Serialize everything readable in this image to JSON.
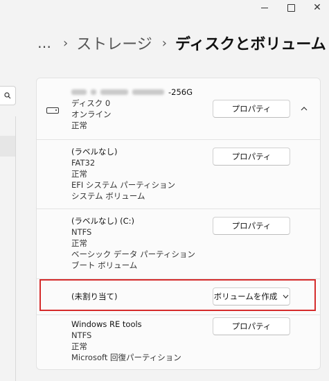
{
  "window_controls": {
    "close_glyph": "✕"
  },
  "breadcrumb": {
    "more": "…",
    "separator": "›",
    "parent": "ストレージ",
    "current": "ディスクとボリューム"
  },
  "disk": {
    "title_suffix": "-256G",
    "name": "ディスク 0",
    "status": "オンライン",
    "health": "正常",
    "properties_label": "プロパティ",
    "collapse_icon": "chevron-up-icon"
  },
  "partitions": [
    {
      "label": "(ラベルなし)",
      "fs": "FAT32",
      "health": "正常",
      "type": "EFI システム パーティション",
      "role": "システム ボリューム",
      "action": "プロパティ"
    },
    {
      "label": "(ラベルなし) (C:)",
      "fs": "NTFS",
      "health": "正常",
      "type": "ベーシック データ パーティション",
      "role": "ブート ボリューム",
      "action": "プロパティ"
    },
    {
      "label": "(未割り当て)",
      "action": "ボリュームを作成",
      "action_icon": "chevron-down-icon"
    },
    {
      "label": "Windows RE tools",
      "fs": "NTFS",
      "health": "正常",
      "type": "Microsoft 回復パーティション",
      "action": "プロパティ"
    }
  ],
  "colors": {
    "highlight": "#d52b2b",
    "background": "#f3f3f3",
    "card": "#fbfbfb"
  }
}
